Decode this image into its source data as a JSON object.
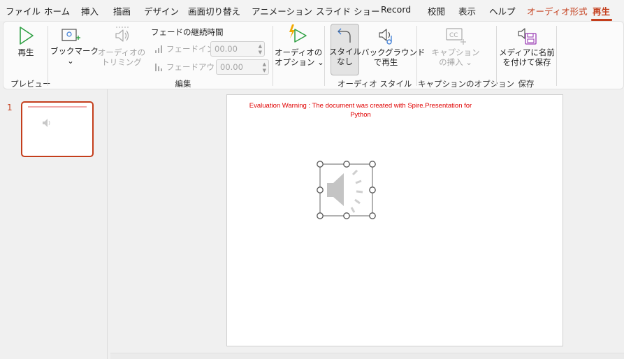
{
  "menu": [
    "ファイル",
    "ホーム",
    "挿入",
    "描画",
    "デザイン",
    "画面切り替え",
    "アニメーション",
    "スライド ショー",
    "Record",
    "校閲",
    "表示",
    "ヘルプ",
    "オーディオ形式",
    "再生"
  ],
  "colors": {
    "accent": "#c43e1c",
    "warning": "#e00000",
    "play_green": "#2ea043",
    "disabled": "#a6a6a6"
  },
  "ribbon": {
    "play": {
      "label": "再生",
      "icon": "play-icon"
    },
    "group_preview": "プレビュー",
    "bookmark": {
      "label": "ブックマーク",
      "chevron": "⌄",
      "icon": "bookmark-icon"
    },
    "trim": {
      "label1": "オーディオの",
      "label2": "トリミング",
      "icon": "audio-trim-icon"
    },
    "fade_title": "フェードの継続時間",
    "fade_in_label": "フェードイン:",
    "fade_in_value": "00.00",
    "fade_out_label": "フェードアウト:",
    "fade_out_value": "00.00",
    "group_edit": "編集",
    "audio_options": {
      "label1": "オーディオの",
      "label2": "オプション ⌄",
      "icon": "lightning-play-icon"
    },
    "no_style": {
      "label1": "スタイル",
      "label2": "なし",
      "icon": "undo-arrow-icon"
    },
    "bg_play": {
      "label1": "バックグラウンド",
      "label2": "で再生",
      "icon": "background-speaker-icon"
    },
    "group_audio_style": "オーディオ スタイル",
    "caption_insert": {
      "label1": "キャプション",
      "label2": "の挿入 ⌄",
      "icon": "closed-caption-icon"
    },
    "group_caption": "キャプションのオプション",
    "save_media": {
      "label1": "メディアに名前",
      "label2": "を付けて保存",
      "icon": "save-media-icon"
    },
    "group_save": "保存"
  },
  "slides": {
    "number": "1"
  },
  "slide": {
    "warning_line1": "Evaluation Warning : The document was created with Spire.Presentation for",
    "warning_line2": "Python",
    "audio_icon": "speaker-icon"
  }
}
